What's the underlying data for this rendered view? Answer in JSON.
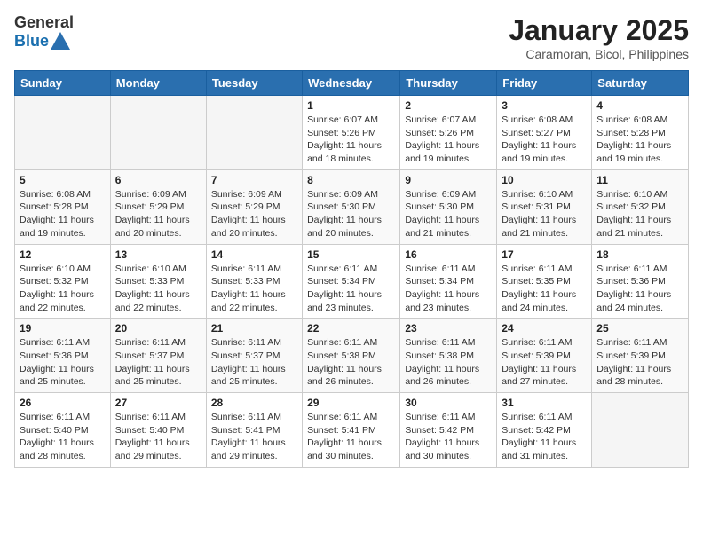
{
  "header": {
    "logo_general": "General",
    "logo_blue": "Blue",
    "month_title": "January 2025",
    "location": "Caramoran, Bicol, Philippines"
  },
  "weekdays": [
    "Sunday",
    "Monday",
    "Tuesday",
    "Wednesday",
    "Thursday",
    "Friday",
    "Saturday"
  ],
  "weeks": [
    [
      {
        "day": "",
        "info": ""
      },
      {
        "day": "",
        "info": ""
      },
      {
        "day": "",
        "info": ""
      },
      {
        "day": "1",
        "info": "Sunrise: 6:07 AM\nSunset: 5:26 PM\nDaylight: 11 hours and 18 minutes."
      },
      {
        "day": "2",
        "info": "Sunrise: 6:07 AM\nSunset: 5:26 PM\nDaylight: 11 hours and 19 minutes."
      },
      {
        "day": "3",
        "info": "Sunrise: 6:08 AM\nSunset: 5:27 PM\nDaylight: 11 hours and 19 minutes."
      },
      {
        "day": "4",
        "info": "Sunrise: 6:08 AM\nSunset: 5:28 PM\nDaylight: 11 hours and 19 minutes."
      }
    ],
    [
      {
        "day": "5",
        "info": "Sunrise: 6:08 AM\nSunset: 5:28 PM\nDaylight: 11 hours and 19 minutes."
      },
      {
        "day": "6",
        "info": "Sunrise: 6:09 AM\nSunset: 5:29 PM\nDaylight: 11 hours and 20 minutes."
      },
      {
        "day": "7",
        "info": "Sunrise: 6:09 AM\nSunset: 5:29 PM\nDaylight: 11 hours and 20 minutes."
      },
      {
        "day": "8",
        "info": "Sunrise: 6:09 AM\nSunset: 5:30 PM\nDaylight: 11 hours and 20 minutes."
      },
      {
        "day": "9",
        "info": "Sunrise: 6:09 AM\nSunset: 5:30 PM\nDaylight: 11 hours and 21 minutes."
      },
      {
        "day": "10",
        "info": "Sunrise: 6:10 AM\nSunset: 5:31 PM\nDaylight: 11 hours and 21 minutes."
      },
      {
        "day": "11",
        "info": "Sunrise: 6:10 AM\nSunset: 5:32 PM\nDaylight: 11 hours and 21 minutes."
      }
    ],
    [
      {
        "day": "12",
        "info": "Sunrise: 6:10 AM\nSunset: 5:32 PM\nDaylight: 11 hours and 22 minutes."
      },
      {
        "day": "13",
        "info": "Sunrise: 6:10 AM\nSunset: 5:33 PM\nDaylight: 11 hours and 22 minutes."
      },
      {
        "day": "14",
        "info": "Sunrise: 6:11 AM\nSunset: 5:33 PM\nDaylight: 11 hours and 22 minutes."
      },
      {
        "day": "15",
        "info": "Sunrise: 6:11 AM\nSunset: 5:34 PM\nDaylight: 11 hours and 23 minutes."
      },
      {
        "day": "16",
        "info": "Sunrise: 6:11 AM\nSunset: 5:34 PM\nDaylight: 11 hours and 23 minutes."
      },
      {
        "day": "17",
        "info": "Sunrise: 6:11 AM\nSunset: 5:35 PM\nDaylight: 11 hours and 24 minutes."
      },
      {
        "day": "18",
        "info": "Sunrise: 6:11 AM\nSunset: 5:36 PM\nDaylight: 11 hours and 24 minutes."
      }
    ],
    [
      {
        "day": "19",
        "info": "Sunrise: 6:11 AM\nSunset: 5:36 PM\nDaylight: 11 hours and 25 minutes."
      },
      {
        "day": "20",
        "info": "Sunrise: 6:11 AM\nSunset: 5:37 PM\nDaylight: 11 hours and 25 minutes."
      },
      {
        "day": "21",
        "info": "Sunrise: 6:11 AM\nSunset: 5:37 PM\nDaylight: 11 hours and 25 minutes."
      },
      {
        "day": "22",
        "info": "Sunrise: 6:11 AM\nSunset: 5:38 PM\nDaylight: 11 hours and 26 minutes."
      },
      {
        "day": "23",
        "info": "Sunrise: 6:11 AM\nSunset: 5:38 PM\nDaylight: 11 hours and 26 minutes."
      },
      {
        "day": "24",
        "info": "Sunrise: 6:11 AM\nSunset: 5:39 PM\nDaylight: 11 hours and 27 minutes."
      },
      {
        "day": "25",
        "info": "Sunrise: 6:11 AM\nSunset: 5:39 PM\nDaylight: 11 hours and 28 minutes."
      }
    ],
    [
      {
        "day": "26",
        "info": "Sunrise: 6:11 AM\nSunset: 5:40 PM\nDaylight: 11 hours and 28 minutes."
      },
      {
        "day": "27",
        "info": "Sunrise: 6:11 AM\nSunset: 5:40 PM\nDaylight: 11 hours and 29 minutes."
      },
      {
        "day": "28",
        "info": "Sunrise: 6:11 AM\nSunset: 5:41 PM\nDaylight: 11 hours and 29 minutes."
      },
      {
        "day": "29",
        "info": "Sunrise: 6:11 AM\nSunset: 5:41 PM\nDaylight: 11 hours and 30 minutes."
      },
      {
        "day": "30",
        "info": "Sunrise: 6:11 AM\nSunset: 5:42 PM\nDaylight: 11 hours and 30 minutes."
      },
      {
        "day": "31",
        "info": "Sunrise: 6:11 AM\nSunset: 5:42 PM\nDaylight: 11 hours and 31 minutes."
      },
      {
        "day": "",
        "info": ""
      }
    ]
  ]
}
